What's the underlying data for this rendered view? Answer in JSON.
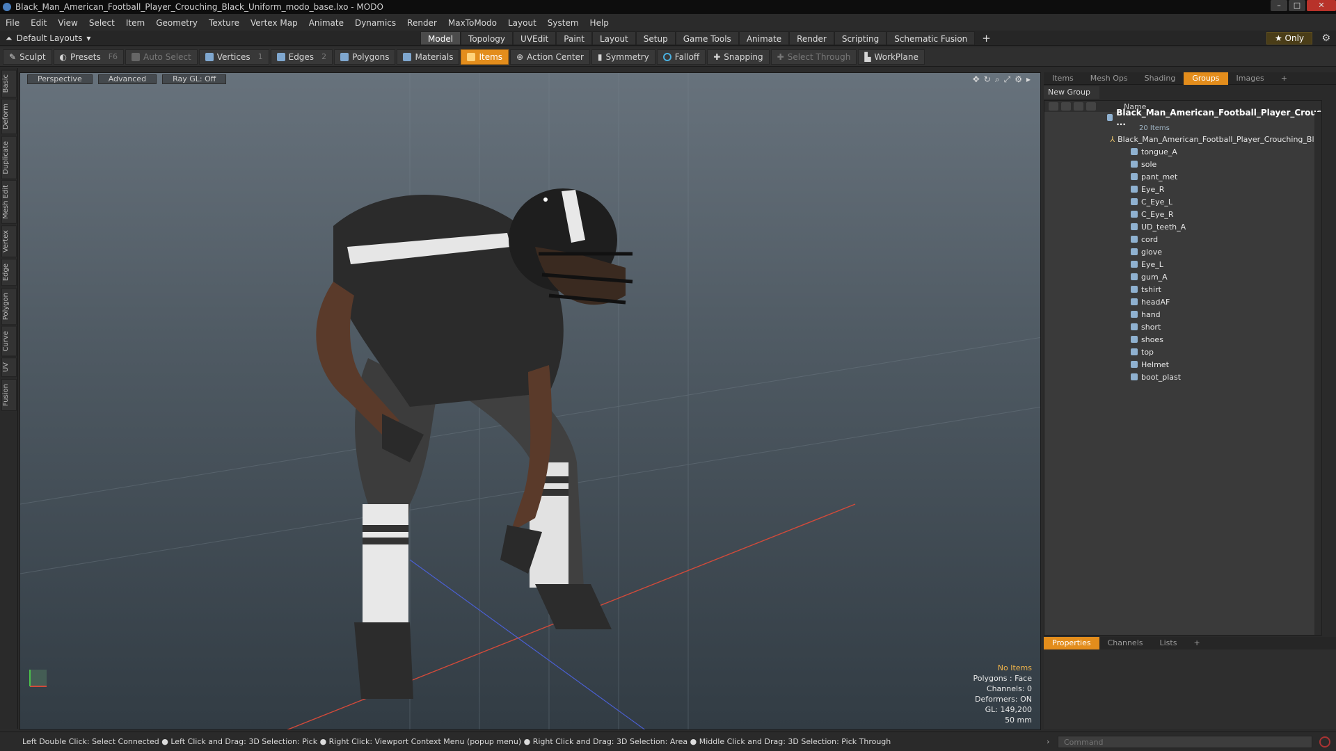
{
  "window": {
    "title": "Black_Man_American_Football_Player_Crouching_Black_Uniform_modo_base.lxo - MODO",
    "controls": [
      "–",
      "□",
      "✕"
    ]
  },
  "menu": [
    "File",
    "Edit",
    "View",
    "Select",
    "Item",
    "Geometry",
    "Texture",
    "Vertex Map",
    "Animate",
    "Dynamics",
    "Render",
    "MaxToModo",
    "Layout",
    "System",
    "Help"
  ],
  "layout": {
    "dropdown": "Default Layouts",
    "tabs": [
      "Model",
      "Topology",
      "UVEdit",
      "Paint",
      "Layout",
      "Setup",
      "Game Tools",
      "Animate",
      "Render",
      "Scripting",
      "Schematic Fusion"
    ],
    "active_tab": "Model",
    "only_label": "★ Only"
  },
  "toolbar": {
    "sculpt": "Sculpt",
    "presets": "Presets",
    "presets_key": "F6",
    "auto_select": "Auto Select",
    "vertices": "Vertices",
    "vertices_key": "1",
    "edges": "Edges",
    "edges_key": "2",
    "polygons": "Polygons",
    "materials": "Materials",
    "items": "Items",
    "action_center": "Action Center",
    "symmetry": "Symmetry",
    "falloff": "Falloff",
    "snapping": "Snapping",
    "select_through": "Select Through",
    "workplane": "WorkPlane"
  },
  "left_tabs": [
    "Basic",
    "Deform",
    "Duplicate",
    "Mesh Edit",
    "Vertex",
    "Edge",
    "Polygon",
    "Curve",
    "UV",
    "Fusion"
  ],
  "viewport": {
    "view": "Perspective",
    "shading": "Advanced",
    "raygl": "Ray GL: Off",
    "info": {
      "items": "No Items",
      "polygons": "Polygons : Face",
      "channels": "Channels: 0",
      "deformers": "Deformers: ON",
      "gl": "GL: 149,200",
      "focal": "50 mm"
    }
  },
  "right_panel": {
    "tabs": [
      "Items",
      "Mesh Ops",
      "Shading",
      "Groups",
      "Images"
    ],
    "active_tab": "Groups",
    "new_group": "New Group",
    "column_name": "Name",
    "group_name": "Black_Man_American_Football_Player_Crouc ...",
    "group_count": "20 Items",
    "locator": "Black_Man_American_Football_Player_Crouching_Bl...",
    "items": [
      "tongue_A",
      "sole",
      "pant_met",
      "Eye_R",
      "C_Eye_L",
      "C_Eye_R",
      "UD_teeth_A",
      "cord",
      "glove",
      "Eye_L",
      "gum_A",
      "tshirt",
      "headAF",
      "hand",
      "short",
      "shoes",
      "top",
      "Helmet",
      "boot_plast"
    ],
    "props_tabs": [
      "Properties",
      "Channels",
      "Lists"
    ],
    "props_active": "Properties"
  },
  "status": {
    "hint": "Left Double Click: Select Connected ● Left Click and Drag: 3D Selection: Pick ● Right Click: Viewport Context Menu (popup menu) ● Right Click and Drag: 3D Selection: Area ● Middle Click and Drag: 3D Selection: Pick Through",
    "command_placeholder": "Command"
  },
  "colors": {
    "accent": "#e38d1c",
    "viewport_top": "#67727c",
    "viewport_bottom": "#323c44"
  }
}
